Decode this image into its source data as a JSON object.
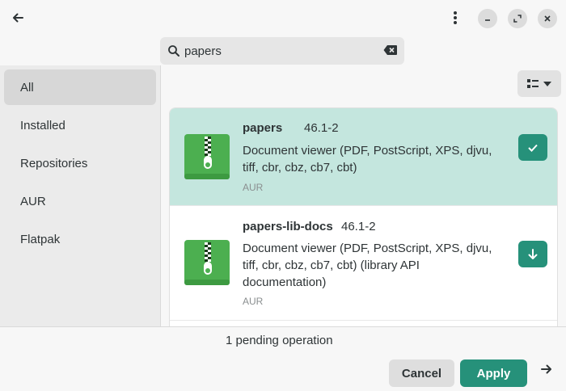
{
  "header": {
    "back_icon": "arrow-left-icon",
    "menu_icon": "kebab-menu-icon",
    "window_controls": [
      "minimize-icon",
      "maximize-icon",
      "close-icon"
    ]
  },
  "search": {
    "value": "papers",
    "placeholder": "",
    "icon": "search-icon",
    "clear_icon": "backspace-clear-icon"
  },
  "sidebar": {
    "items": [
      {
        "label": "All",
        "active": true
      },
      {
        "label": "Installed",
        "active": false
      },
      {
        "label": "Repositories",
        "active": false
      },
      {
        "label": "AUR",
        "active": false
      },
      {
        "label": "Flatpak",
        "active": false
      }
    ]
  },
  "toolbar": {
    "view_icon": "list-view-icon"
  },
  "packages": [
    {
      "name": "papers",
      "version": "46.1-2",
      "description_lines": [
        "Document viewer (PDF, PostScript, XPS, djvu,",
        "tiff, cbr, cbz, cb7, cbt)"
      ],
      "repo": "AUR",
      "status": "selected",
      "action_icon": "check-icon"
    },
    {
      "name": "papers-lib-docs",
      "version": "46.1-2",
      "description_lines": [
        "Document viewer (PDF, PostScript, XPS, djvu,",
        "tiff, cbr, cbz, cb7, cbt) (library API",
        "documentation)"
      ],
      "repo": "AUR",
      "status": "not-installed",
      "action_icon": "download-icon"
    }
  ],
  "footer": {
    "pending_text": "1 pending operation",
    "cancel_label": "Cancel",
    "apply_label": "Apply",
    "next_icon": "arrow-right-icon"
  },
  "colors": {
    "accent": "#26917a",
    "selected_row": "#c4e6de",
    "sidebar_bg": "#ebebeb",
    "window_bg": "#f7f7f7"
  }
}
